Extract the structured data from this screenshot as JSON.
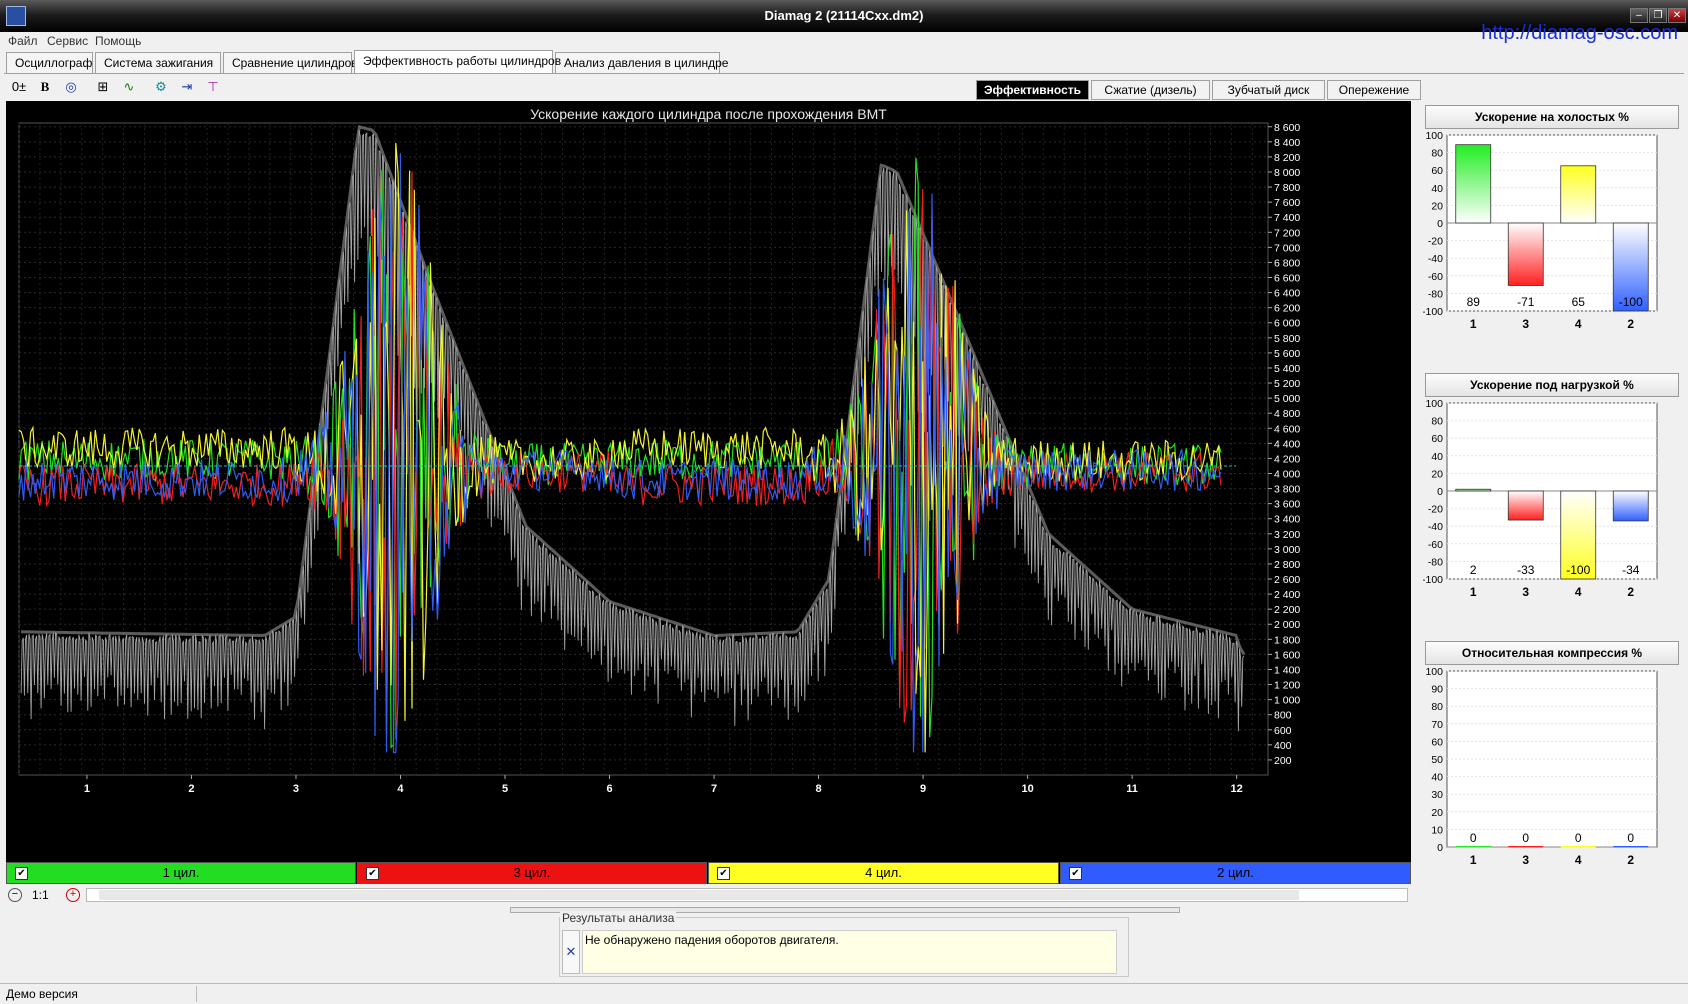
{
  "window": {
    "title": "Diamag 2 (21114Cxx.dm2)",
    "controls": [
      "–",
      "❐",
      "✕"
    ]
  },
  "menu": {
    "items": [
      "Файл",
      "Сервис",
      "Помощь"
    ],
    "site_link": "http://diamag-osc.com"
  },
  "tabs": [
    {
      "label": "Осциллограф",
      "active": false
    },
    {
      "label": "Система зажигания",
      "active": false
    },
    {
      "label": "Сравнение цилиндров",
      "active": false
    },
    {
      "label": "Эффективность работы цилиндров",
      "active": true
    },
    {
      "label": "Анализ давления в цилиндре",
      "active": false
    }
  ],
  "toolbar": {
    "icons": [
      "offset-icon",
      "bold-icon",
      "rpm-icon",
      "marker-icon",
      "curve-icon",
      "scope-icon",
      "cursor-right-icon",
      "cursor-icon"
    ]
  },
  "subtabs": [
    {
      "label": "Эффективность",
      "active": true
    },
    {
      "label": "Сжатие (дизель)",
      "active": false
    },
    {
      "label": "Зубчатый диск",
      "active": false
    },
    {
      "label": "Опережение",
      "active": false
    }
  ],
  "chart_data": [
    {
      "type": "line",
      "title": "Ускорение каждого цилиндра после прохождения ВМТ",
      "x_ticks": [
        "1",
        "2",
        "3",
        "4",
        "5",
        "6",
        "7",
        "8",
        "9",
        "10",
        "11",
        "12"
      ],
      "y_ticks": [
        "200",
        "400",
        "600",
        "800",
        "1 000",
        "1 200",
        "1 400",
        "1 600",
        "1 800",
        "2 000",
        "2 200",
        "2 400",
        "2 600",
        "2 800",
        "3 000",
        "3 200",
        "3 400",
        "3 600",
        "3 800",
        "4 000",
        "4 200",
        "4 400",
        "4 600",
        "4 800",
        "5 000",
        "5 200",
        "5 400",
        "5 600",
        "5 800",
        "6 000",
        "6 200",
        "6 400",
        "6 600",
        "6 800",
        "7 000",
        "7 200",
        "7 400",
        "7 600",
        "7 800",
        "8 000",
        "8 200",
        "8 400",
        "8 600"
      ],
      "ylim": [
        0,
        8650
      ],
      "xlim": [
        0.35,
        12.3
      ],
      "grid": true,
      "rpm_envelope": {
        "x": [
          0.35,
          2.7,
          3.0,
          3.6,
          3.75,
          4.3,
          5.2,
          6.0,
          7.0,
          7.8,
          8.1,
          8.6,
          8.75,
          9.3,
          10.2,
          11.0,
          12.0,
          12.05
        ],
        "y": [
          1900,
          1850,
          2100,
          8600,
          8550,
          6500,
          3300,
          2300,
          1850,
          1900,
          2600,
          8100,
          8000,
          6200,
          3200,
          2200,
          1850,
          1600
        ]
      },
      "series": [
        {
          "name": "1 цил.",
          "color": "#22ee22"
        },
        {
          "name": "3 цил.",
          "color": "#ff2020"
        },
        {
          "name": "4 цил.",
          "color": "#ffff30"
        },
        {
          "name": "2 цил.",
          "color": "#3060ff"
        }
      ],
      "baseline": 4100
    },
    {
      "type": "bar",
      "title": "Ускорение на холостых %",
      "categories": [
        "1",
        "3",
        "4",
        "2"
      ],
      "values": [
        89,
        -71,
        65,
        -100
      ],
      "colors": [
        "#22ee22",
        "#ff2020",
        "#ffff20",
        "#3060ff"
      ],
      "y_ticks": [
        "100",
        "80",
        "60",
        "40",
        "20",
        "0",
        "-20",
        "-40",
        "-60",
        "-80",
        "-100"
      ],
      "ylim": [
        -100,
        100
      ]
    },
    {
      "type": "bar",
      "title": "Ускорение под нагрузкой %",
      "categories": [
        "1",
        "3",
        "4",
        "2"
      ],
      "values": [
        2,
        -33,
        -100,
        -34
      ],
      "colors": [
        "#22ee22",
        "#ff2020",
        "#ffff20",
        "#3060ff"
      ],
      "y_ticks": [
        "100",
        "80",
        "60",
        "40",
        "20",
        "0",
        "-20",
        "-40",
        "-60",
        "-80",
        "-100"
      ],
      "ylim": [
        -100,
        100
      ]
    },
    {
      "type": "bar",
      "title": "Относительная компрессия %",
      "categories": [
        "1",
        "3",
        "4",
        "2"
      ],
      "values": [
        0,
        0,
        0,
        0
      ],
      "colors": [
        "#22ee22",
        "#ff2020",
        "#ffff20",
        "#3060ff"
      ],
      "y_ticks": [
        "100",
        "90",
        "80",
        "70",
        "60",
        "50",
        "40",
        "30",
        "20",
        "10",
        "0"
      ],
      "ylim": [
        0,
        100
      ]
    }
  ],
  "legend": [
    {
      "label": "1 цил.",
      "color": "#22dd22",
      "checked": true
    },
    {
      "label": "3 цил.",
      "color": "#ee1111",
      "checked": true
    },
    {
      "label": "4 цил.",
      "color": "#ffff22",
      "checked": true
    },
    {
      "label": "2 цил.",
      "color": "#2f5bff",
      "checked": true
    }
  ],
  "zoom": {
    "label": "1:1"
  },
  "results": {
    "legend": "Результаты анализа",
    "text": "Не обнаружено падения оборотов двигателя."
  },
  "status": {
    "text": "Демо версия"
  }
}
